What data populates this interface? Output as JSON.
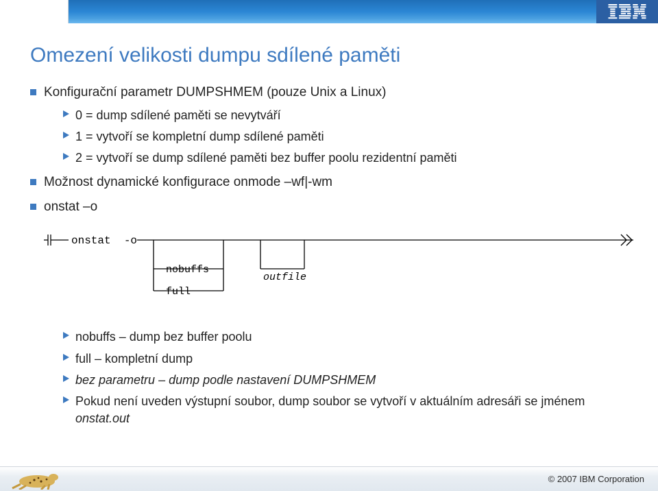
{
  "header": {
    "brand": "IBM"
  },
  "title": "Omezení velikosti dumpu sdílené paměti",
  "content": {
    "p1": "Konfigurační parametr DUMPSHMEM (pouze Unix a Linux)",
    "p1_items": {
      "i0": "0 = dump sdílené paměti se nevytváří",
      "i1": "1 = vytvoří se kompletní dump sdílené paměti",
      "i2": "2 = vytvoří se dump sdílené paměti bez buffer poolu rezidentní paměti"
    },
    "p2": "Možnost dynamické konfigurace onmode –wf|-wm",
    "p3": "onstat –o",
    "diagram": {
      "cmd": "onstat  -o",
      "opt_nobuffs": "nobuffs",
      "opt_full": "full",
      "opt_outfile": "outfile"
    },
    "p3_items": {
      "i0": "nobuffs – dump bez buffer poolu",
      "i1": "full – kompletní dump",
      "i2_em": "bez parametru",
      "i2_rest": " – dump podle nastavení DUMPSHMEM",
      "i3_lead": "Pokud není uveden výstupní soubor, dump soubor se vytvoří v aktuálním adresáři se jménem ",
      "i3_em": "onstat.out"
    }
  },
  "footer": {
    "copyright": "© 2007 IBM Corporation"
  }
}
